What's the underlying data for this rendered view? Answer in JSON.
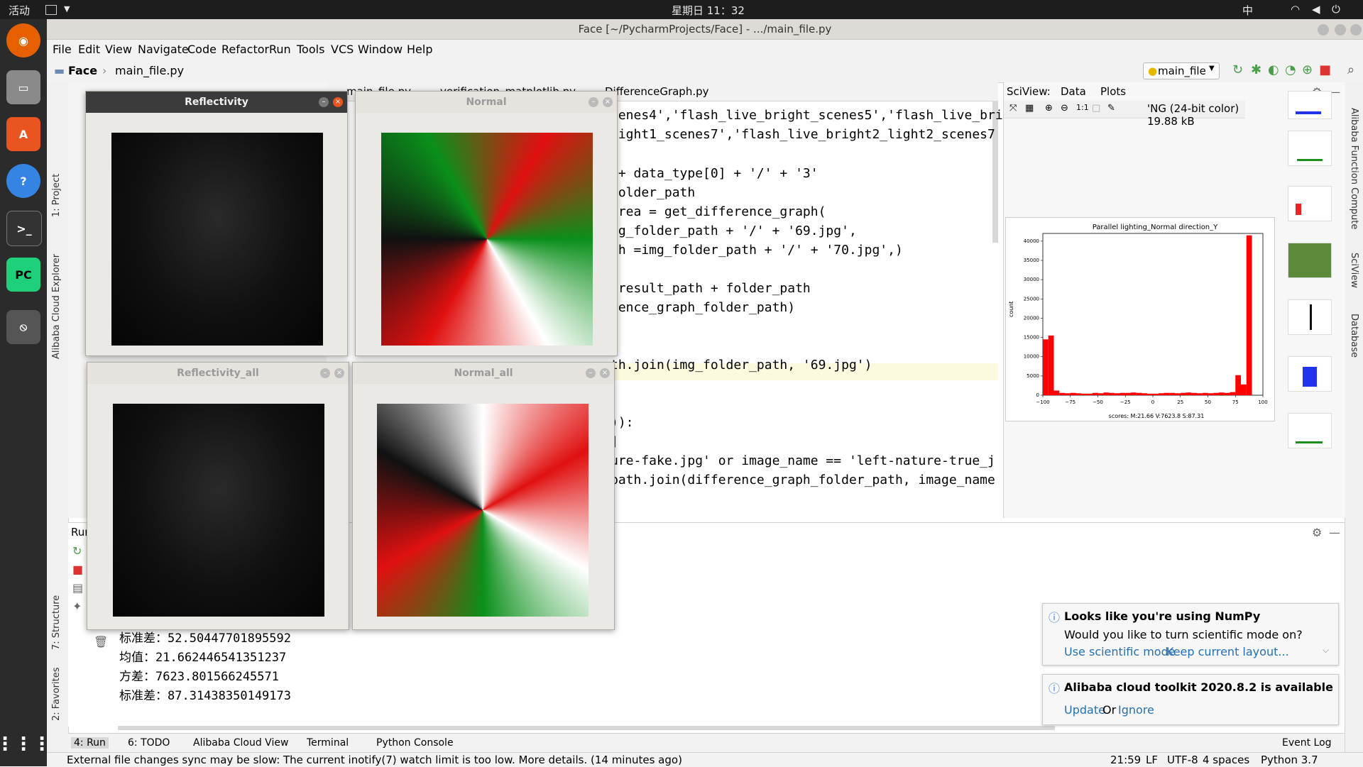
{
  "topbar": {
    "activities": "活动",
    "clock": "星期日 11：32",
    "input_method": "中"
  },
  "window": {
    "title": "Face [~/PycharmProjects/Face] - .../main_file.py"
  },
  "menu": [
    "File",
    "Edit",
    "View",
    "Navigate",
    "Code",
    "Refactor",
    "Run",
    "Tools",
    "VCS",
    "Window",
    "Help"
  ],
  "nav": {
    "project": "Face",
    "file": "main_file.py",
    "run_config": "main_file"
  },
  "editor_tabs": [
    "main_file.py",
    "verification_matplotlib.py",
    "DifferenceGraph.py"
  ],
  "code_lines": [
    {
      "text": "cenes4','flash_live_bright_scenes5','flash_live_bri"
    },
    {
      "text": "light1_scenes7','flash_live_bright2_light2_scenes7"
    },
    {
      "text": " + data_type[0] + '/' + '3'"
    },
    {
      "text": "folder_path"
    },
    {
      "text": "area = get_difference_graph("
    },
    {
      "text": "mg_folder_path + '/' + '69.jpg',"
    },
    {
      "text": "th =img_folder_path + '/' + '70.jpg',)"
    },
    {
      "text": " result_path + folder_path"
    },
    {
      "text": "rence_graph_folder_path)"
    },
    {
      "text": "th.join(img_folder_path, '69.jpg')"
    },
    {
      "text": ")):"
    },
    {
      "text": "]"
    },
    {
      "text": "ure-fake.jpg' or image_name == 'left-nature-true_j"
    },
    {
      "text": "path.join(difference_graph_folder_path, image_name"
    }
  ],
  "sciview": {
    "tabs": [
      "SciView:",
      "Data",
      "Plots"
    ],
    "image_info": "'NG (24-bit color) 19.88 kB",
    "plot_title": "Parallel lighting_Normal direction_Y",
    "plot_footer": "scores: M:21.66 V:7623.8 S:87.31",
    "y_label": "count"
  },
  "chart_data": {
    "type": "bar",
    "title": "Parallel lighting_Normal direction_Y",
    "xlabel": "scores: M:21.66 V:7623.8 S:87.31",
    "ylabel": "count",
    "xlim": [
      -100,
      100
    ],
    "ylim": [
      0,
      42000
    ],
    "x_ticks": [
      -100,
      -75,
      -50,
      -25,
      0,
      25,
      50,
      75,
      100
    ],
    "y_ticks": [
      0,
      5000,
      10000,
      15000,
      20000,
      25000,
      30000,
      35000,
      40000
    ],
    "bins": [
      -100,
      -95,
      -90,
      -85,
      -80,
      -75,
      -70,
      -65,
      -60,
      -55,
      -50,
      -45,
      -40,
      -35,
      -30,
      -25,
      -20,
      -15,
      -10,
      -5,
      0,
      5,
      10,
      15,
      20,
      25,
      30,
      35,
      40,
      45,
      50,
      55,
      60,
      65,
      70,
      75,
      80,
      85,
      90,
      95
    ],
    "values": [
      14500,
      15500,
      1200,
      600,
      500,
      600,
      500,
      400,
      400,
      600,
      500,
      700,
      600,
      500,
      600,
      600,
      700,
      600,
      500,
      400,
      400,
      500,
      600,
      600,
      500,
      600,
      700,
      600,
      500,
      600,
      500,
      600,
      700,
      600,
      800,
      5200,
      2800,
      41500,
      0,
      0
    ],
    "color": "#ff0000"
  },
  "run": {
    "label": "Run",
    "lines": [
      "标准差：52.50447701895592",
      "均值：21.662446541351237",
      "方差：7623.801566245571",
      "标准差：87.31438350149173"
    ]
  },
  "cv_windows": [
    {
      "title": "Reflectivity"
    },
    {
      "title": "Normal"
    },
    {
      "title": "Reflectivity_all"
    },
    {
      "title": "Normal_all"
    }
  ],
  "notifications": [
    {
      "title": "Looks like you're using NumPy",
      "body": "Would you like to turn scientific mode on?",
      "link1": "Use scientific mode",
      "link2": "Keep current layout..."
    },
    {
      "title": "Alibaba cloud toolkit 2020.8.2 is available",
      "link1": "Update",
      "middle": "Or",
      "link2": "Ignore"
    }
  ],
  "bottom_tabs": [
    "4: Run",
    "6: TODO",
    "Alibaba Cloud View",
    "Terminal",
    "Python Console"
  ],
  "event_log": "Event Log",
  "status": {
    "message": "External file changes sync may be slow: The current inotify(7) watch limit is too low. More details. (14 minutes ago)",
    "position": "21:59",
    "line_sep": "LF",
    "encoding": "UTF-8",
    "indent": "4 spaces",
    "interpreter": "Python 3.7"
  },
  "left_tabs": [
    "1: Project",
    "Alibaba Cloud Explorer",
    "7: Structure",
    "2: Favorites"
  ],
  "right_tabs": [
    "Alibaba Function Compute",
    "SciView",
    "Database"
  ]
}
